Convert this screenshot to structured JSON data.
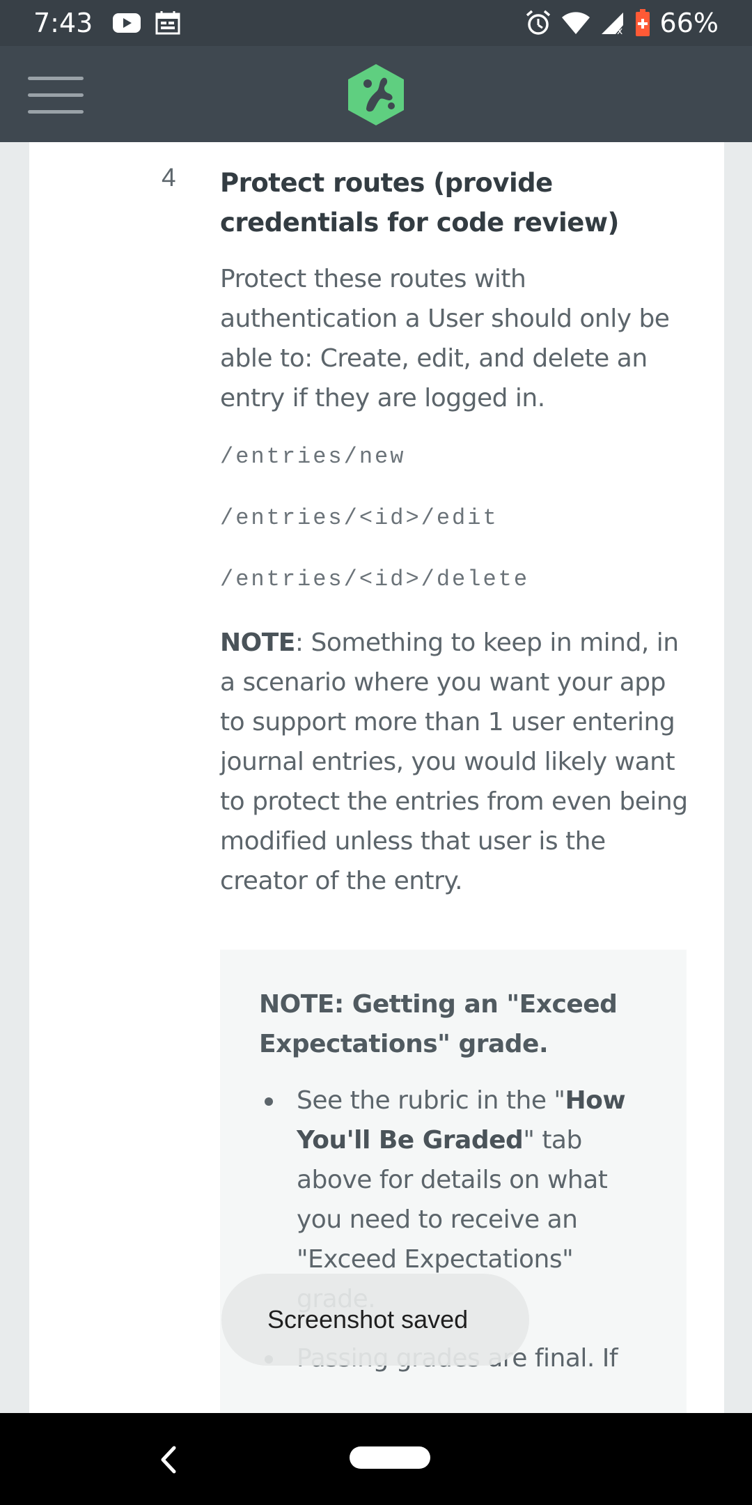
{
  "status_bar": {
    "time": "7:43",
    "battery_percent": "66%",
    "icons": [
      "youtube-icon",
      "calendar-icon",
      "alarm-icon",
      "wifi-icon",
      "signal-icon",
      "battery-icon"
    ]
  },
  "app_bar": {
    "menu_icon": "hamburger-menu-icon",
    "logo_icon": "treehouse-logo-icon",
    "colors": {
      "bar": "#3f4850",
      "logo": "#5fcf80"
    }
  },
  "step": {
    "number": "4",
    "title": "Protect routes (provide credentials for code review)",
    "description": "Protect these routes with authentication a User should only be able to: Create, edit, and delete an entry if they are logged in.",
    "routes": [
      "/entries/new",
      "/entries/<id>/edit",
      "/entries/<id>/delete"
    ],
    "note_label": "NOTE",
    "note_text": ": Something to keep in mind, in a scenario where you want your app to support more than 1 user entering journal entries, you would likely want to protect the entries from even being modified unless that user is the creator of the entry."
  },
  "callout": {
    "title": "NOTE: Getting an \"Exceed Expectations\" grade.",
    "bullet1_pre": "See the rubric in the \"",
    "bullet1_bold": "How You'll Be Graded",
    "bullet1_post": "\" tab above for details on what you need to receive an \"Exceed Expectations\" grade.",
    "bullet2": "Passing grades are final. If"
  },
  "toast": {
    "text": "Screenshot saved"
  },
  "nav_bar": {
    "back_icon": "back-chevron-icon",
    "home_icon": "home-pill-icon"
  }
}
